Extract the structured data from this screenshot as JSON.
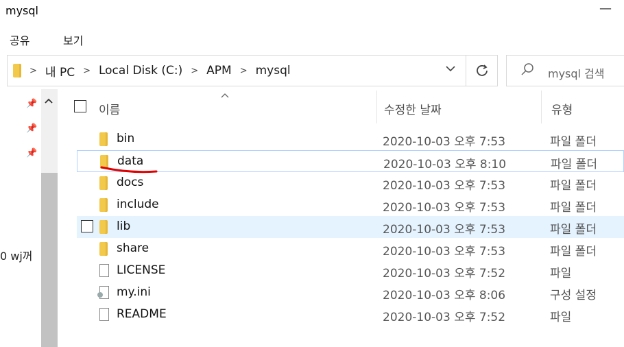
{
  "window": {
    "title": "mysql",
    "close_glyph": "—"
  },
  "ribbon": {
    "tabs": [
      "공유",
      "보기"
    ]
  },
  "address": {
    "crumbs": [
      "내 PC",
      "Local Disk (C:)",
      "APM",
      "mysql"
    ]
  },
  "search": {
    "placeholder": "mysql 검색"
  },
  "nav": {
    "fragment_text": "0 wj꺼"
  },
  "columns": {
    "name": "이름",
    "date": "수정한 날짜",
    "type": "유형"
  },
  "files": [
    {
      "name": "bin",
      "date": "2020-10-03 오후 7:53",
      "type": "파일 폴더",
      "icon": "folder-icon"
    },
    {
      "name": "data",
      "date": "2020-10-03 오후 8:10",
      "type": "파일 폴더",
      "icon": "folder-icon"
    },
    {
      "name": "docs",
      "date": "2020-10-03 오후 7:53",
      "type": "파일 폴더",
      "icon": "folder-icon"
    },
    {
      "name": "include",
      "date": "2020-10-03 오후 7:53",
      "type": "파일 폴더",
      "icon": "folder-icon"
    },
    {
      "name": "lib",
      "date": "2020-10-03 오후 7:53",
      "type": "파일 폴더",
      "icon": "folder-icon"
    },
    {
      "name": "share",
      "date": "2020-10-03 오후 7:53",
      "type": "파일 폴더",
      "icon": "folder-icon"
    },
    {
      "name": "LICENSE",
      "date": "2020-10-03 오후 7:52",
      "type": "파일",
      "icon": "file-icon"
    },
    {
      "name": "my.ini",
      "date": "2020-10-03 오후 8:06",
      "type": "구성 설정",
      "icon": "config-file-icon"
    },
    {
      "name": "README",
      "date": "2020-10-03 오후 7:52",
      "type": "파일",
      "icon": "file-icon"
    }
  ],
  "colors": {
    "hover_row": "#e5f3ff",
    "folder": "#f3c94b",
    "annotation": "#e00000"
  }
}
